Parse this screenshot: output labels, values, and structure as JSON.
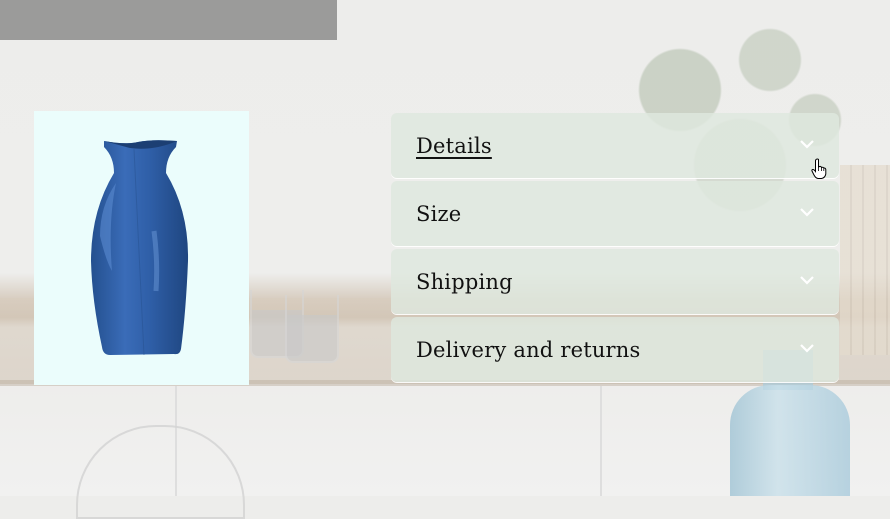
{
  "accordion": {
    "items": [
      {
        "label": "Details",
        "active": true
      },
      {
        "label": "Size",
        "active": false
      },
      {
        "label": "Shipping",
        "active": false
      },
      {
        "label": "Delivery and returns",
        "active": false
      }
    ]
  },
  "product": {
    "image": "blue-ceramic-vase",
    "vase_color": "#2f5fa8",
    "card_background": "#ebfdfc"
  },
  "icons": {
    "chevron": "chevron-down-icon",
    "cursor": "hand-pointer-cursor"
  }
}
